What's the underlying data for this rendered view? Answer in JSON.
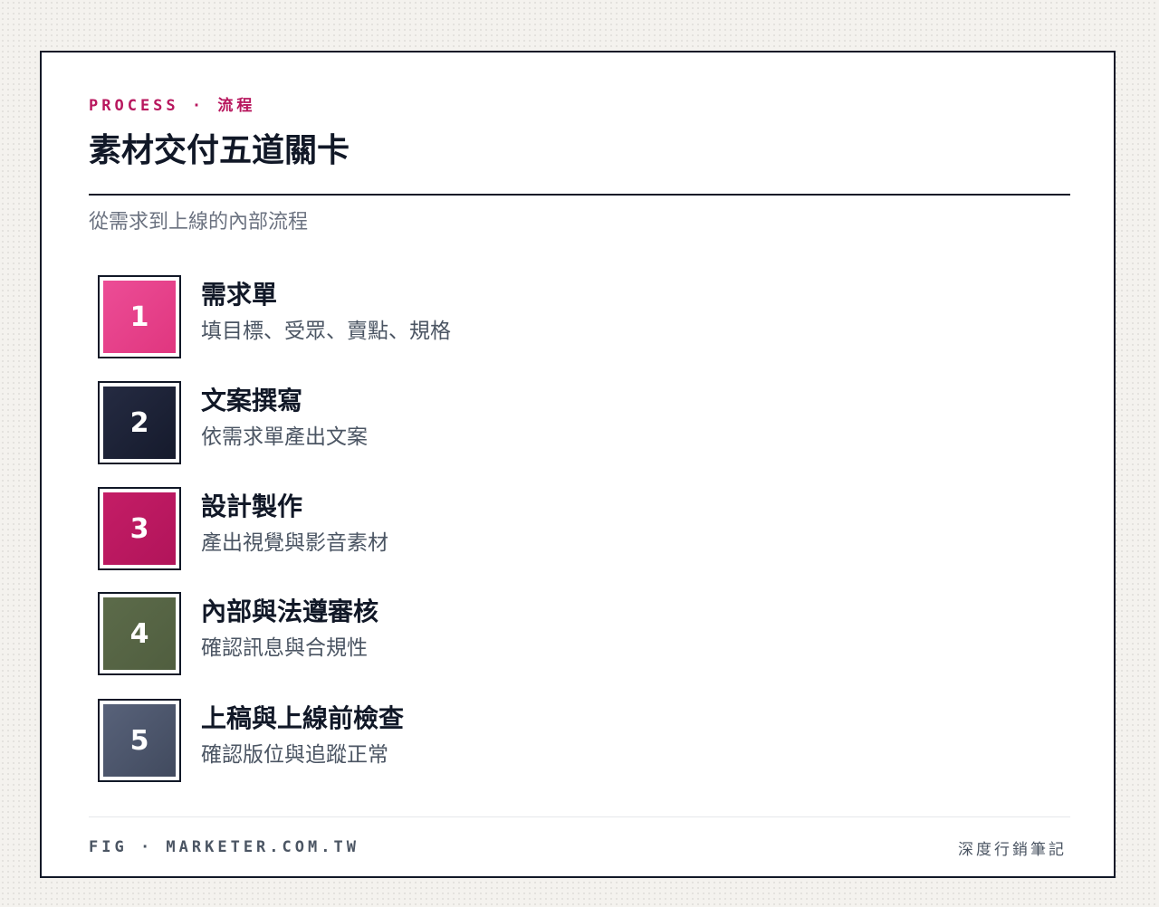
{
  "header": {
    "eyebrow": "PROCESS · 流程",
    "title": "素材交付五道關卡",
    "subtitle": "從需求到上線的內部流程"
  },
  "steps": [
    {
      "number": "1",
      "title": "需求單",
      "description": "填目標、受眾、賣點、規格",
      "color": "#e0367f",
      "color_light": "#ec4d96"
    },
    {
      "number": "2",
      "title": "文案撰寫",
      "description": "依需求單產出文案",
      "color": "#151a2c",
      "color_light": "#252b42"
    },
    {
      "number": "3",
      "title": "設計製作",
      "description": "產出視覺與影音素材",
      "color": "#b1145a",
      "color_light": "#c41d66"
    },
    {
      "number": "4",
      "title": "內部與法遵審核",
      "description": "確認訊息與合規性",
      "color": "#505e3f",
      "color_light": "#5c6b4a"
    },
    {
      "number": "5",
      "title": "上稿與上線前檢查",
      "description": "確認版位與追蹤正常",
      "color": "#414a5e",
      "color_light": "#58627a"
    }
  ],
  "footer": {
    "left": "FIG · MARKETER.COM.TW",
    "right": "深度行銷筆記"
  },
  "colors": {
    "accent": "#b8175e",
    "ink": "#111827",
    "muted": "#6b7280"
  }
}
